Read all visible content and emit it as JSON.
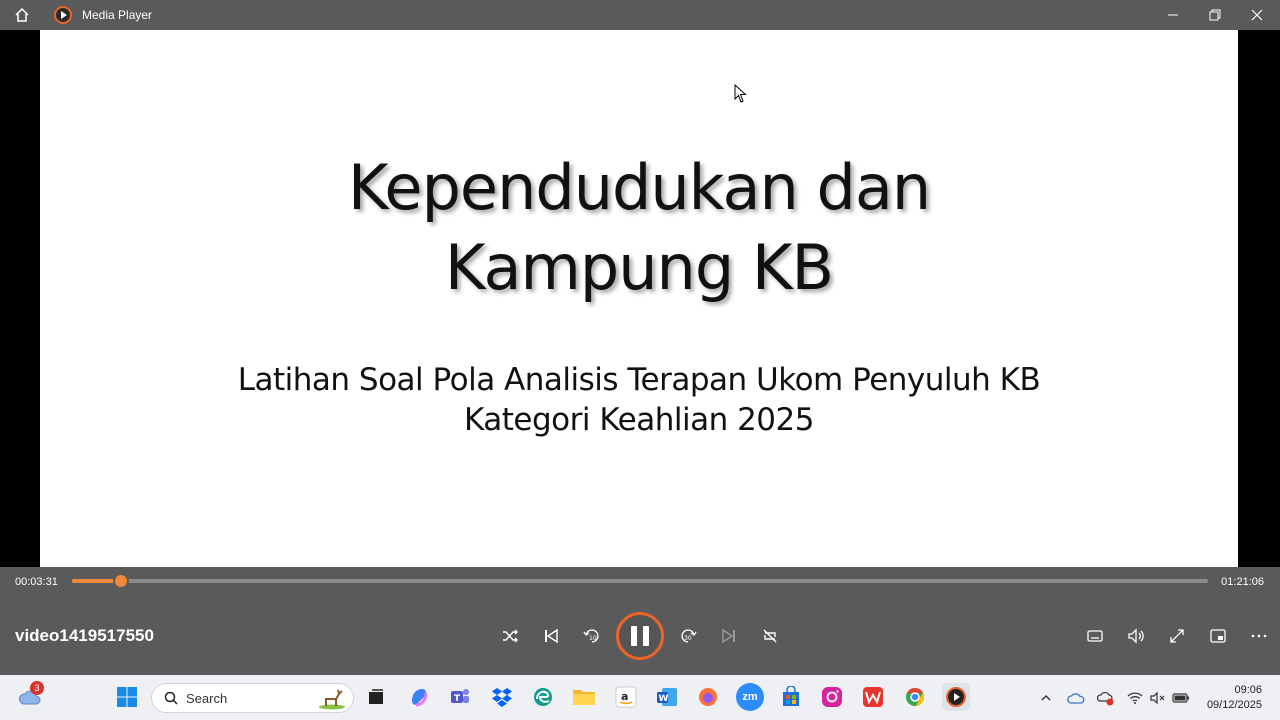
{
  "window": {
    "title": "Media Player"
  },
  "slide": {
    "title_line1": "Kependudukan dan",
    "title_line2": "Kampung KB",
    "subtitle_line1": "Latihan Soal Pola Analisis Terapan Ukom Penyuluh KB",
    "subtitle_line2": "Kategori Keahlian 2025"
  },
  "player": {
    "current_time": "00:03:31",
    "total_time": "01:21:06",
    "progress_fraction": 0.0434,
    "video_name": "video1419517550",
    "accent_color": "#e8642c"
  },
  "taskbar": {
    "search_placeholder": "Search",
    "weather_badge": "3",
    "clock_time": "09:06",
    "clock_date": "09/12/2025",
    "zoom_label": "zm"
  }
}
